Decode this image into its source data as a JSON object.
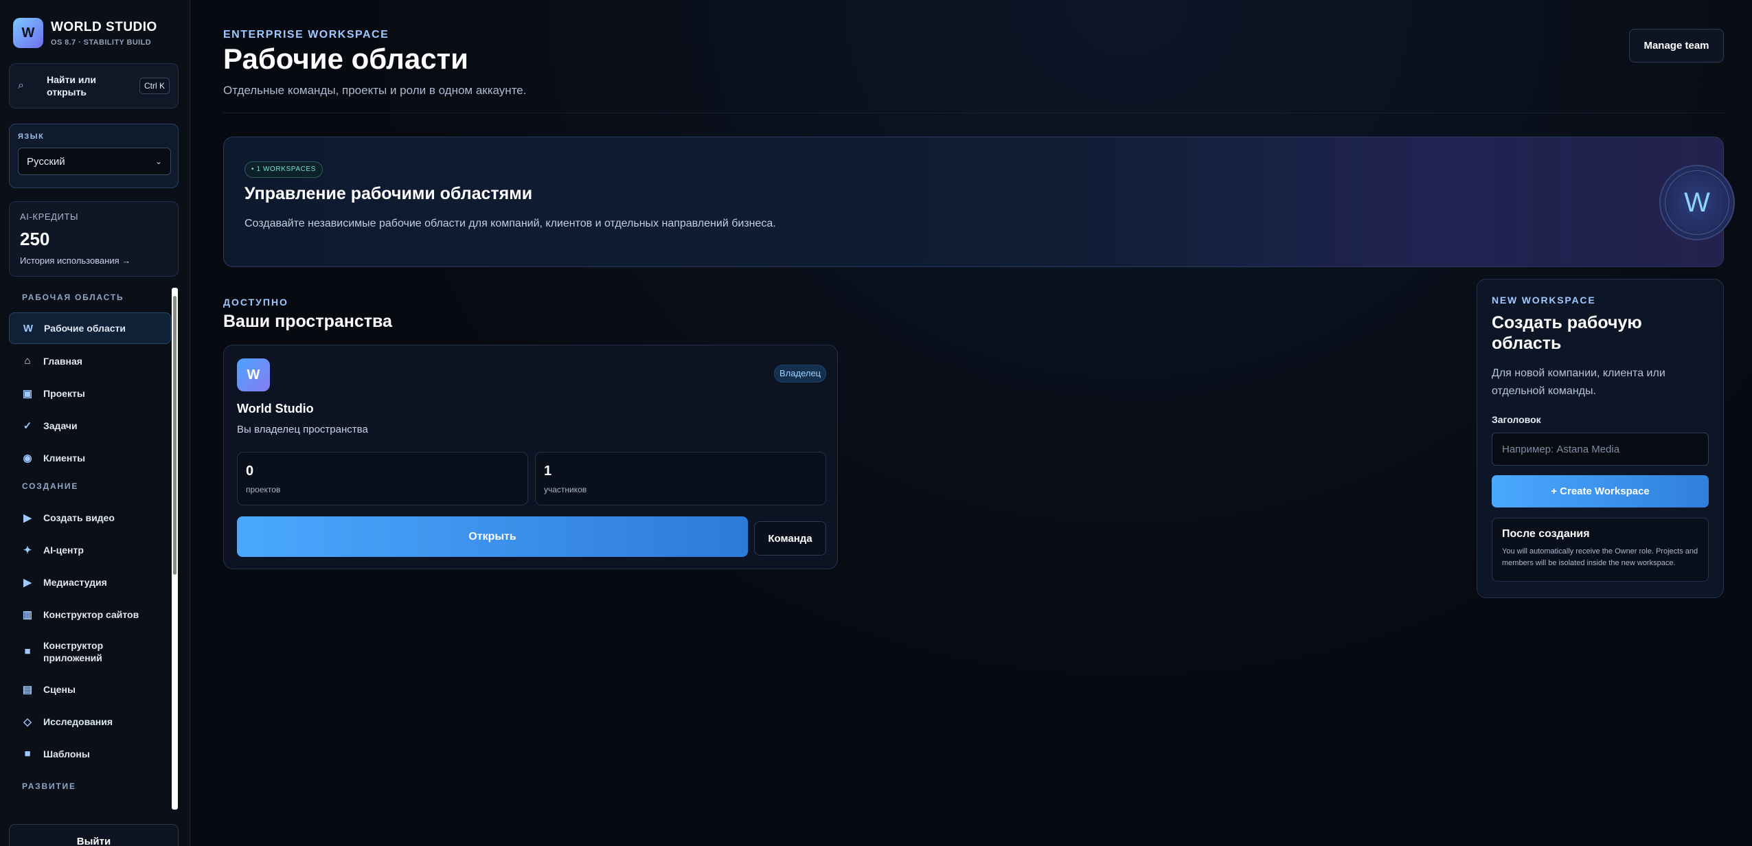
{
  "brand": {
    "logo_letter": "W",
    "title": "WORLD STUDIO",
    "subtitle": "OS 8.7 · STABILITY BUILD"
  },
  "search": {
    "label": "Найти или открыть",
    "shortcut": "Ctrl K"
  },
  "language": {
    "label": "ЯЗЫК",
    "selected": "Русский"
  },
  "credits": {
    "label": "AI-КРЕДИТЫ",
    "value": "250",
    "link": "История использования →"
  },
  "nav": {
    "section_workspace": "РАБОЧАЯ ОБЛАСТЬ",
    "workspace_items": [
      {
        "label": "Рабочие области",
        "icon": "W"
      },
      {
        "label": "Главная",
        "icon": "⌂"
      },
      {
        "label": "Проекты",
        "icon": "▣"
      },
      {
        "label": "Задачи",
        "icon": "✓"
      },
      {
        "label": "Клиенты",
        "icon": "◉"
      }
    ],
    "section_create": "СОЗДАНИЕ",
    "create_items": [
      {
        "label": "Создать видео",
        "icon": "▶"
      },
      {
        "label": "AI-центр",
        "icon": "✦"
      },
      {
        "label": "Медиастудия",
        "icon": "▶"
      },
      {
        "label": "Конструктор сайтов",
        "icon": "▥"
      },
      {
        "label": "Конструктор приложений",
        "icon": "■"
      },
      {
        "label": "Сцены",
        "icon": "▤"
      },
      {
        "label": "Исследования",
        "icon": "◇"
      },
      {
        "label": "Шаблоны",
        "icon": "■"
      }
    ],
    "section_growth": "РАЗВИТИЕ"
  },
  "logout_label": "Выйти",
  "header": {
    "eyebrow": "ENTERPRISE WORKSPACE",
    "title": "Рабочие области",
    "subtitle": "Отдельные команды, проекты и роли в одном аккаунте.",
    "manage_button": "Manage team"
  },
  "hero": {
    "badge": "• 1 WORKSPACES",
    "title": "Управление рабочими областями",
    "subtitle": "Создавайте независимые рабочие области для компаний, клиентов и отдельных направлений бизнеса.",
    "avatar_letter": "W"
  },
  "available": {
    "eyebrow": "ДОСТУПНО",
    "title": "Ваши пространства"
  },
  "workspace_card": {
    "logo_letter": "W",
    "role": "Владелец",
    "name": "World Studio",
    "description": "Вы владелец пространства",
    "stats": [
      {
        "value": "0",
        "label": "проектов"
      },
      {
        "value": "1",
        "label": "участников"
      }
    ],
    "open_button": "Открыть",
    "team_button": "Команда"
  },
  "create_panel": {
    "eyebrow": "NEW WORKSPACE",
    "title": "Создать рабочую область",
    "description": "Для новой компании, клиента или отдельной команды.",
    "field_label": "Заголовок",
    "field_placeholder": "Например: Astana Media",
    "field_value": "",
    "button": "+ Create Workspace",
    "info_title": "После создания",
    "info_text": "You will automatically receive the Owner role. Projects and members will be isolated inside the new workspace."
  },
  "colors": {
    "accent": "#4aa9ff",
    "background": "#070a10",
    "panel": "#0c1424"
  }
}
